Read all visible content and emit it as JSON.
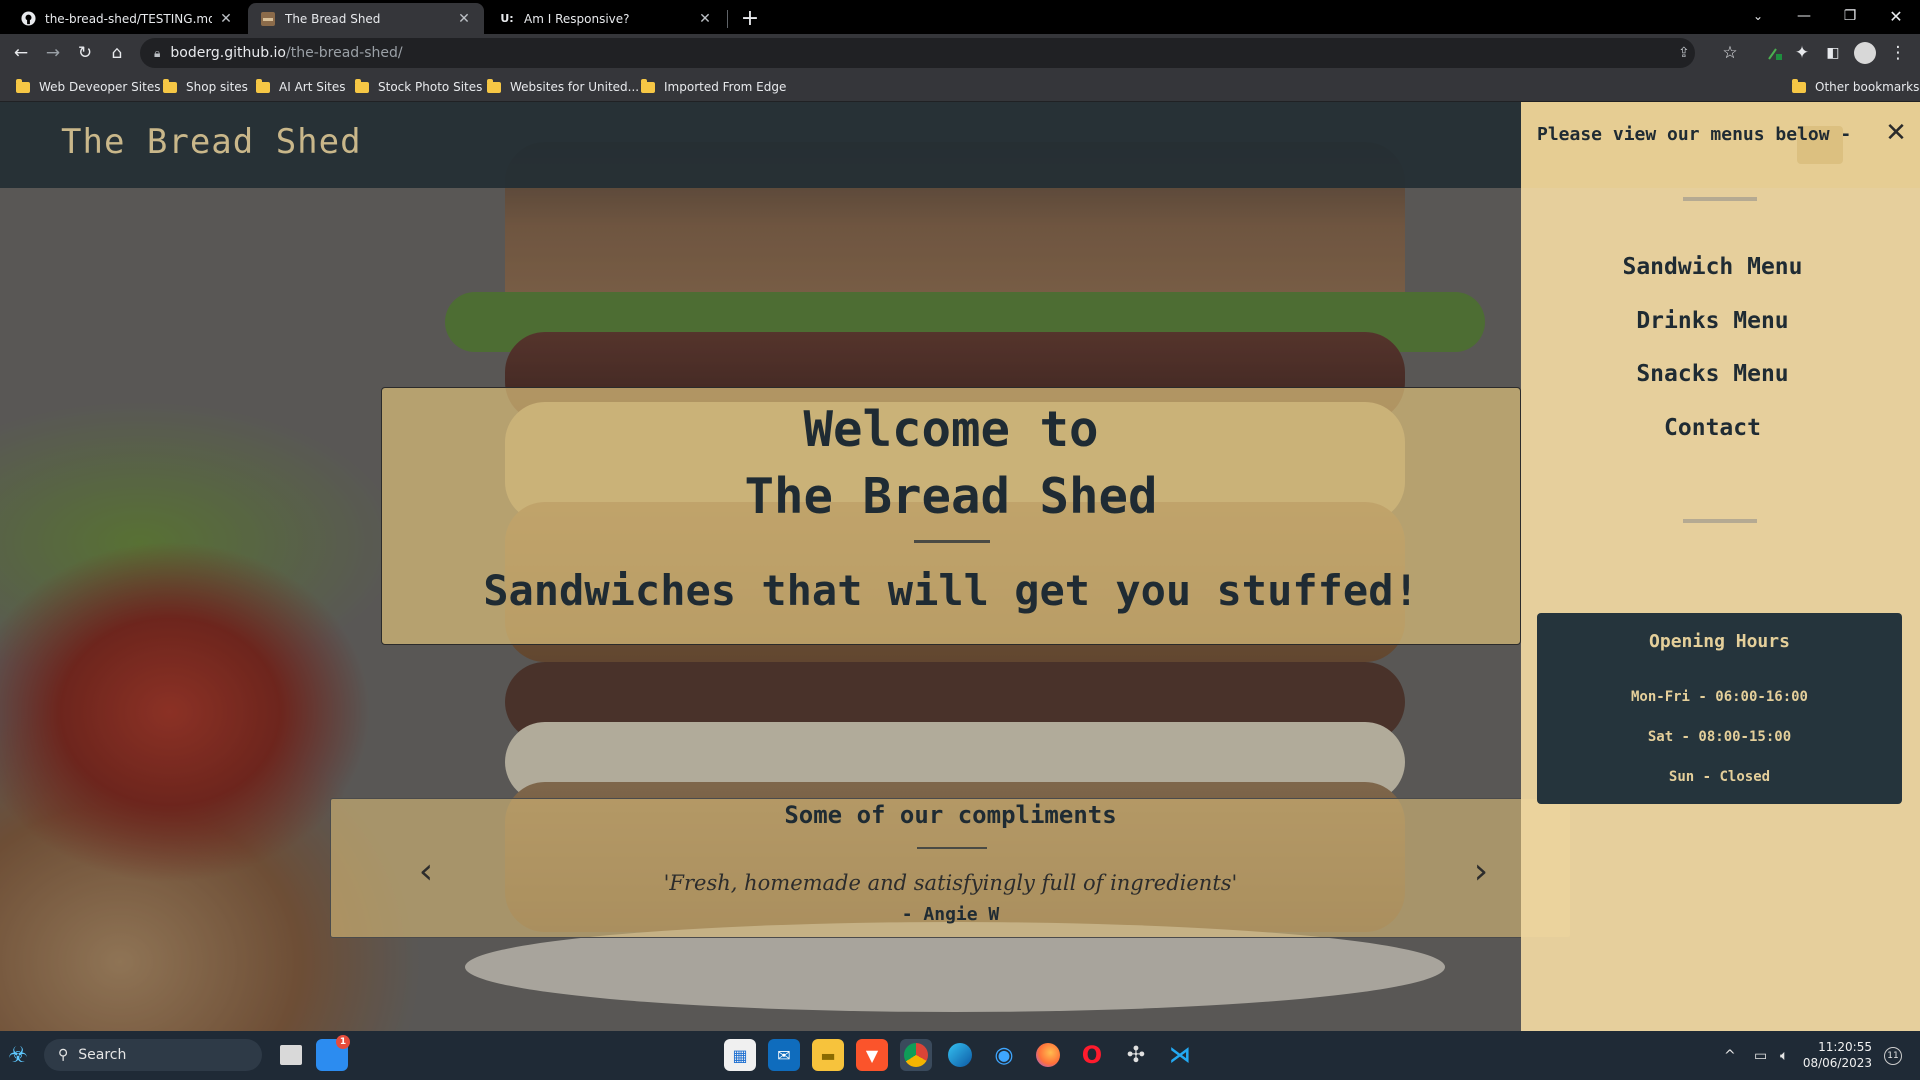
{
  "browser": {
    "tabs": [
      {
        "title": "the-bread-shed/TESTING.md at m",
        "icon": "github-icon",
        "active": false
      },
      {
        "title": "The Bread Shed",
        "icon": "site-favicon",
        "active": true
      },
      {
        "title": "Am I Responsive?",
        "icon": "amiresponsive-icon",
        "active": false
      }
    ],
    "url_host": "boderg.github.io",
    "url_path": "/the-bread-shed/",
    "bookmarks": [
      "Web Deveoper Sites",
      "Shop sites",
      "AI Art Sites",
      "Stock Photo Sites",
      "Websites for United...",
      "Imported From Edge"
    ],
    "other_bookmarks": "Other bookmarks"
  },
  "site": {
    "logo": "The Bread Shed",
    "hero": {
      "line1": "Welcome to",
      "line2": "The Bread Shed",
      "tagline": "Sandwiches that will get you stuffed!"
    },
    "compliments": {
      "heading": "Some of our compliments",
      "quote": "'Fresh, homemade and satisfyingly full of ingredients'",
      "author": "- Angie W"
    }
  },
  "menu": {
    "title": "Please view our menus below -",
    "links": [
      "Sandwich Menu",
      "Drinks Menu",
      "Snacks Menu",
      "Contact"
    ],
    "hours": {
      "title": "Opening Hours",
      "lines": [
        "Mon-Fri - 06:00-16:00",
        "Sat - 08:00-15:00",
        "Sun - Closed"
      ]
    }
  },
  "taskbar": {
    "search_label": "Search",
    "time": "11:20:55",
    "date": "08/06/2023",
    "notification_badge": "1",
    "tray_badge": "11"
  },
  "colors": {
    "header_bg": "#242e34",
    "accent_tan": "#d6ba78",
    "dark_text": "#1f2b33",
    "hours_bg": "#25343c"
  }
}
